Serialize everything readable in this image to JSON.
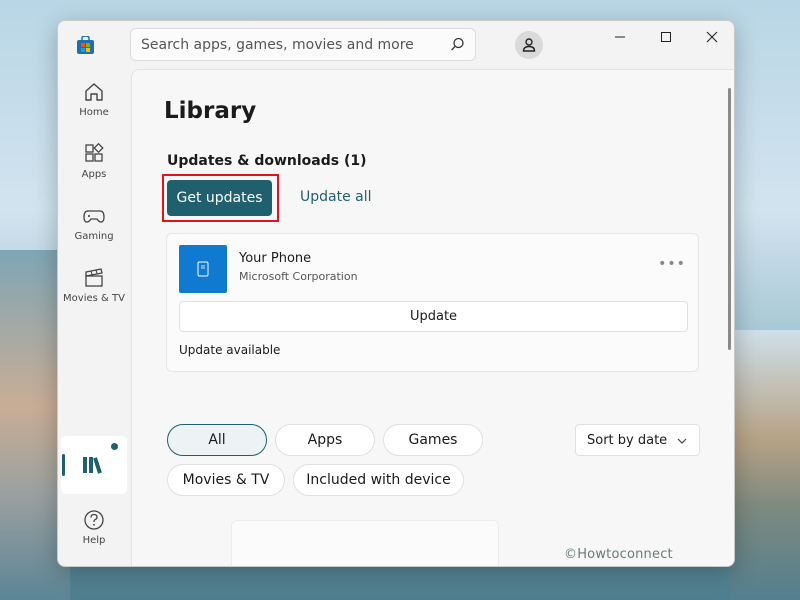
{
  "search": {
    "placeholder": "Search apps, games, movies and more"
  },
  "nav": {
    "items": [
      {
        "label": "Home",
        "icon": "home-icon"
      },
      {
        "label": "Apps",
        "icon": "apps-icon"
      },
      {
        "label": "Gaming",
        "icon": "gaming-icon"
      },
      {
        "label": "Movies & TV",
        "icon": "movies-tv-icon"
      }
    ],
    "library_icon": "library-icon",
    "help": {
      "label": "Help",
      "icon": "help-icon"
    }
  },
  "main": {
    "title": "Library",
    "section_title": "Updates & downloads (1)",
    "get_updates_label": "Get updates",
    "update_all_label": "Update all",
    "app": {
      "name": "Your Phone",
      "publisher": "Microsoft Corporation",
      "more_label": "•••",
      "update_label": "Update",
      "status": "Update available"
    },
    "filters": [
      "All",
      "Apps",
      "Games",
      "Movies & TV",
      "Included with device"
    ],
    "active_filter": "All",
    "sort_label": "Sort by date"
  },
  "watermark": "©Howtoconnect",
  "colors": {
    "accent": "#1f5f6e",
    "highlight": "#e0141e",
    "app_icon_bg": "#0f7ad0"
  }
}
